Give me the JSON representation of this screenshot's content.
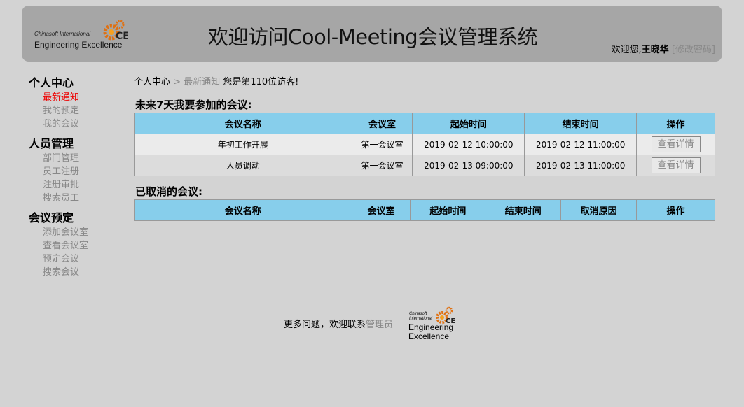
{
  "header": {
    "logo_small": "Chinasoft International",
    "logo_big": "Engineering Excellence",
    "title": "欢迎访问Cool-Meeting会议管理系统",
    "welcome": "欢迎您,",
    "username": "王晓华",
    "change_password": "[修改密码]"
  },
  "sidebar": {
    "groups": [
      {
        "title": "个人中心",
        "items": [
          "最新通知",
          "我的预定",
          "我的会议"
        ]
      },
      {
        "title": "人员管理",
        "items": [
          "部门管理",
          "员工注册",
          "注册审批",
          "搜索员工"
        ]
      },
      {
        "title": "会议预定",
        "items": [
          "添加会议室",
          "查看会议室",
          "预定会议",
          "搜索会议"
        ]
      }
    ]
  },
  "breadcrumb": {
    "root": "个人中心",
    "sep": ">",
    "current": "最新通知",
    "visitor": "您是第110位访客!"
  },
  "upcoming": {
    "title": "未来7天我要参加的会议:",
    "columns": [
      "会议名称",
      "会议室",
      "起始时间",
      "结束时间",
      "操作"
    ],
    "rows": [
      {
        "name": "年初工作开展",
        "room": "第一会议室",
        "start": "2019-02-12 10:00:00",
        "end": "2019-02-12 11:00:00",
        "action": "查看详情"
      },
      {
        "name": "人员调动",
        "room": "第一会议室",
        "start": "2019-02-13 09:00:00",
        "end": "2019-02-13 11:00:00",
        "action": "查看详情"
      }
    ]
  },
  "cancelled": {
    "title": "已取消的会议:",
    "columns": [
      "会议名称",
      "会议室",
      "起始时间",
      "结束时间",
      "取消原因",
      "操作"
    ]
  },
  "footer": {
    "text": "更多问题，欢迎联系",
    "link": "管理员",
    "logo_small": "Chinasoft International",
    "logo_big": "Engineering Excellence"
  },
  "colors": {
    "header_bg": "#a6a6a6",
    "table_header": "#87ceeb",
    "active_nav": "#ee0000"
  }
}
